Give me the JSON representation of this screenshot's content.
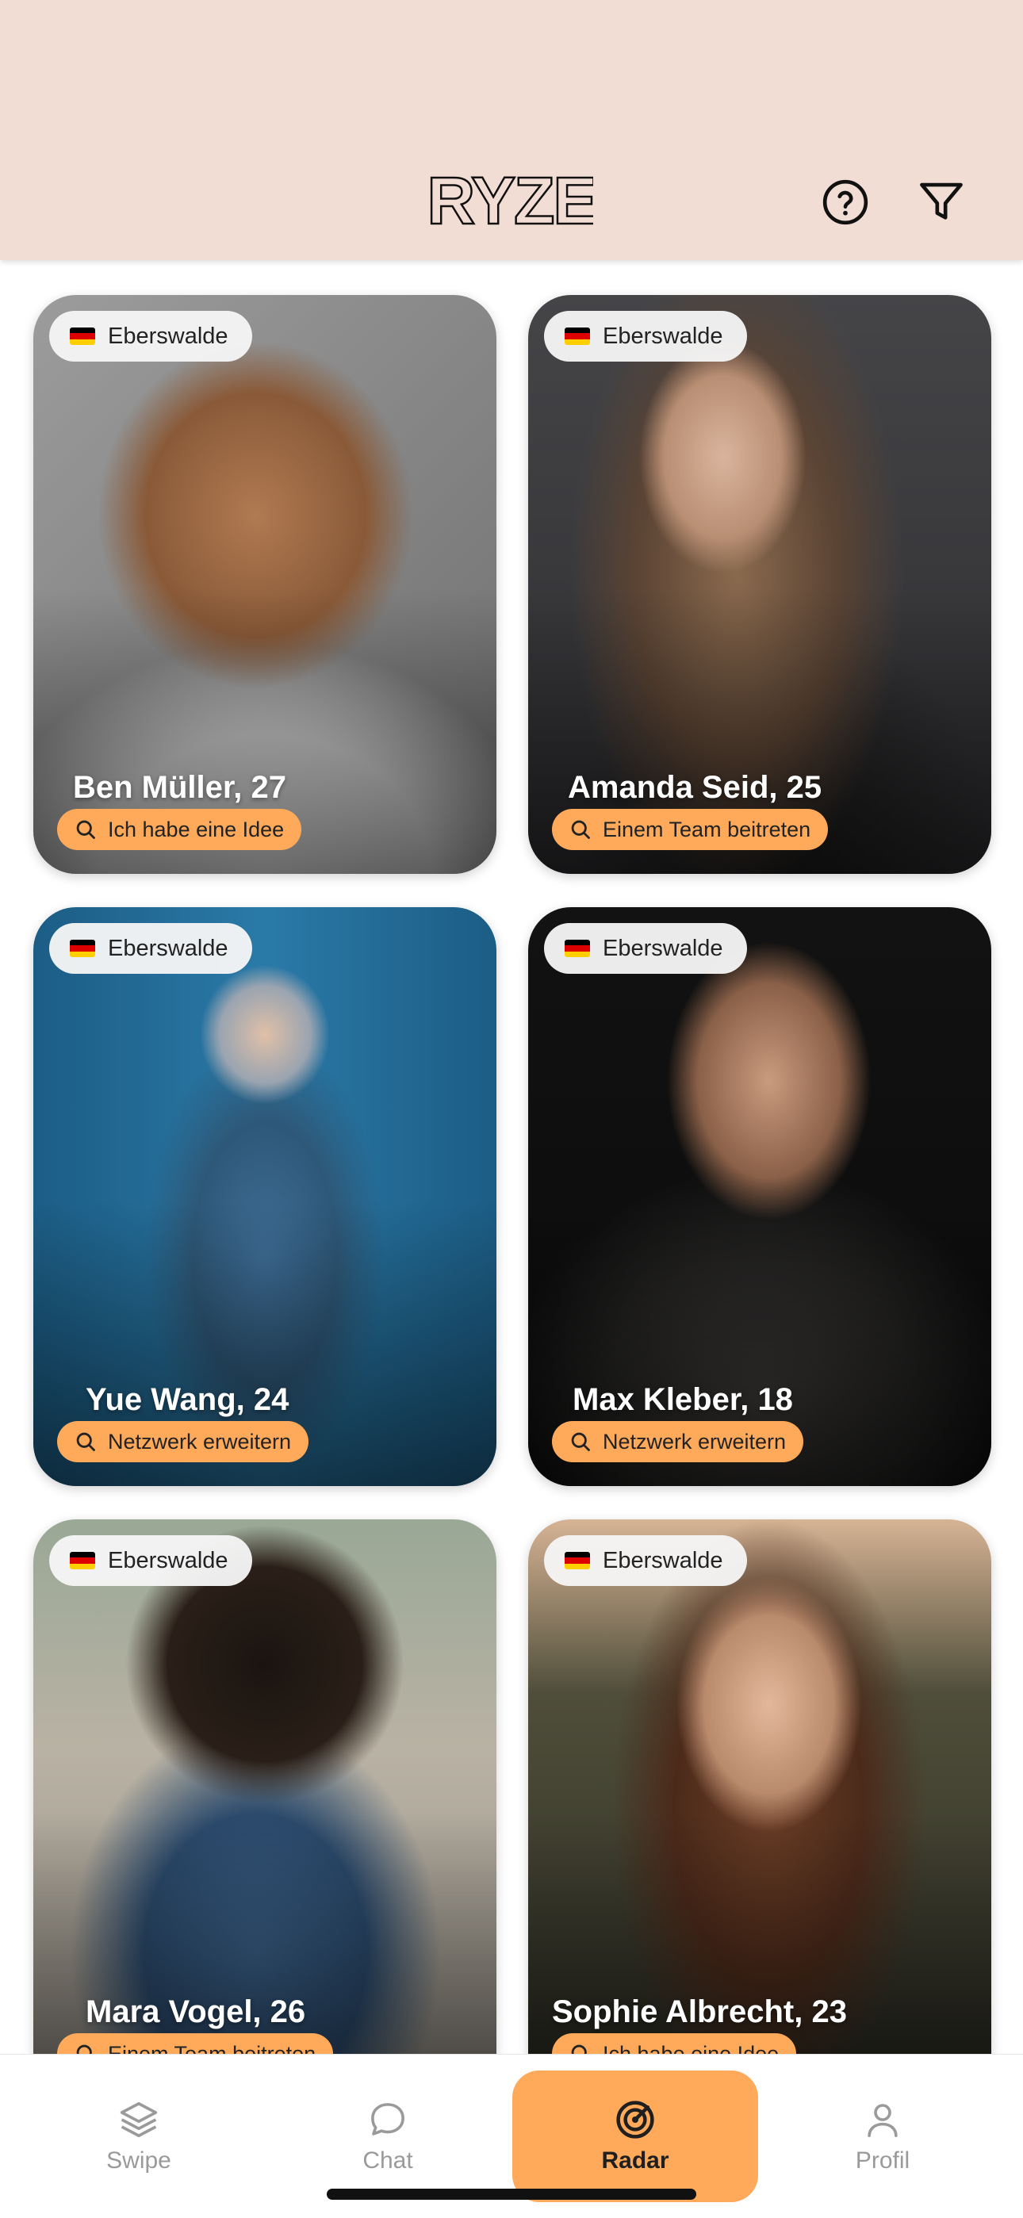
{
  "header": {
    "logo_text": "RYZE",
    "help_icon": "help-circle-icon",
    "filter_icon": "filter-icon"
  },
  "colors": {
    "header_bg": "#f1ddd3",
    "accent": "#ffa95a"
  },
  "profiles": [
    {
      "location": "Eberswalde",
      "name": "Ben Müller, 27",
      "intent": "Ich habe eine Idee"
    },
    {
      "location": "Eberswalde",
      "name": "Amanda Seid, 25",
      "intent": "Einem Team beitreten"
    },
    {
      "location": "Eberswalde",
      "name": "Yue Wang, 24",
      "intent": "Netzwerk erweitern"
    },
    {
      "location": "Eberswalde",
      "name": "Max Kleber, 18",
      "intent": "Netzwerk erweitern"
    },
    {
      "location": "Eberswalde",
      "name": "Mara Vogel, 26",
      "intent": "Einem Team beitreten"
    },
    {
      "location": "Eberswalde",
      "name": "Sophie Albrecht, 23",
      "intent": "Ich habe eine Idee"
    }
  ],
  "nav": [
    {
      "label": "Swipe",
      "icon": "layers-icon"
    },
    {
      "label": "Chat",
      "icon": "chat-bubble-icon"
    },
    {
      "label": "Radar",
      "icon": "radar-icon",
      "active": true
    },
    {
      "label": "Profil",
      "icon": "person-icon"
    }
  ]
}
